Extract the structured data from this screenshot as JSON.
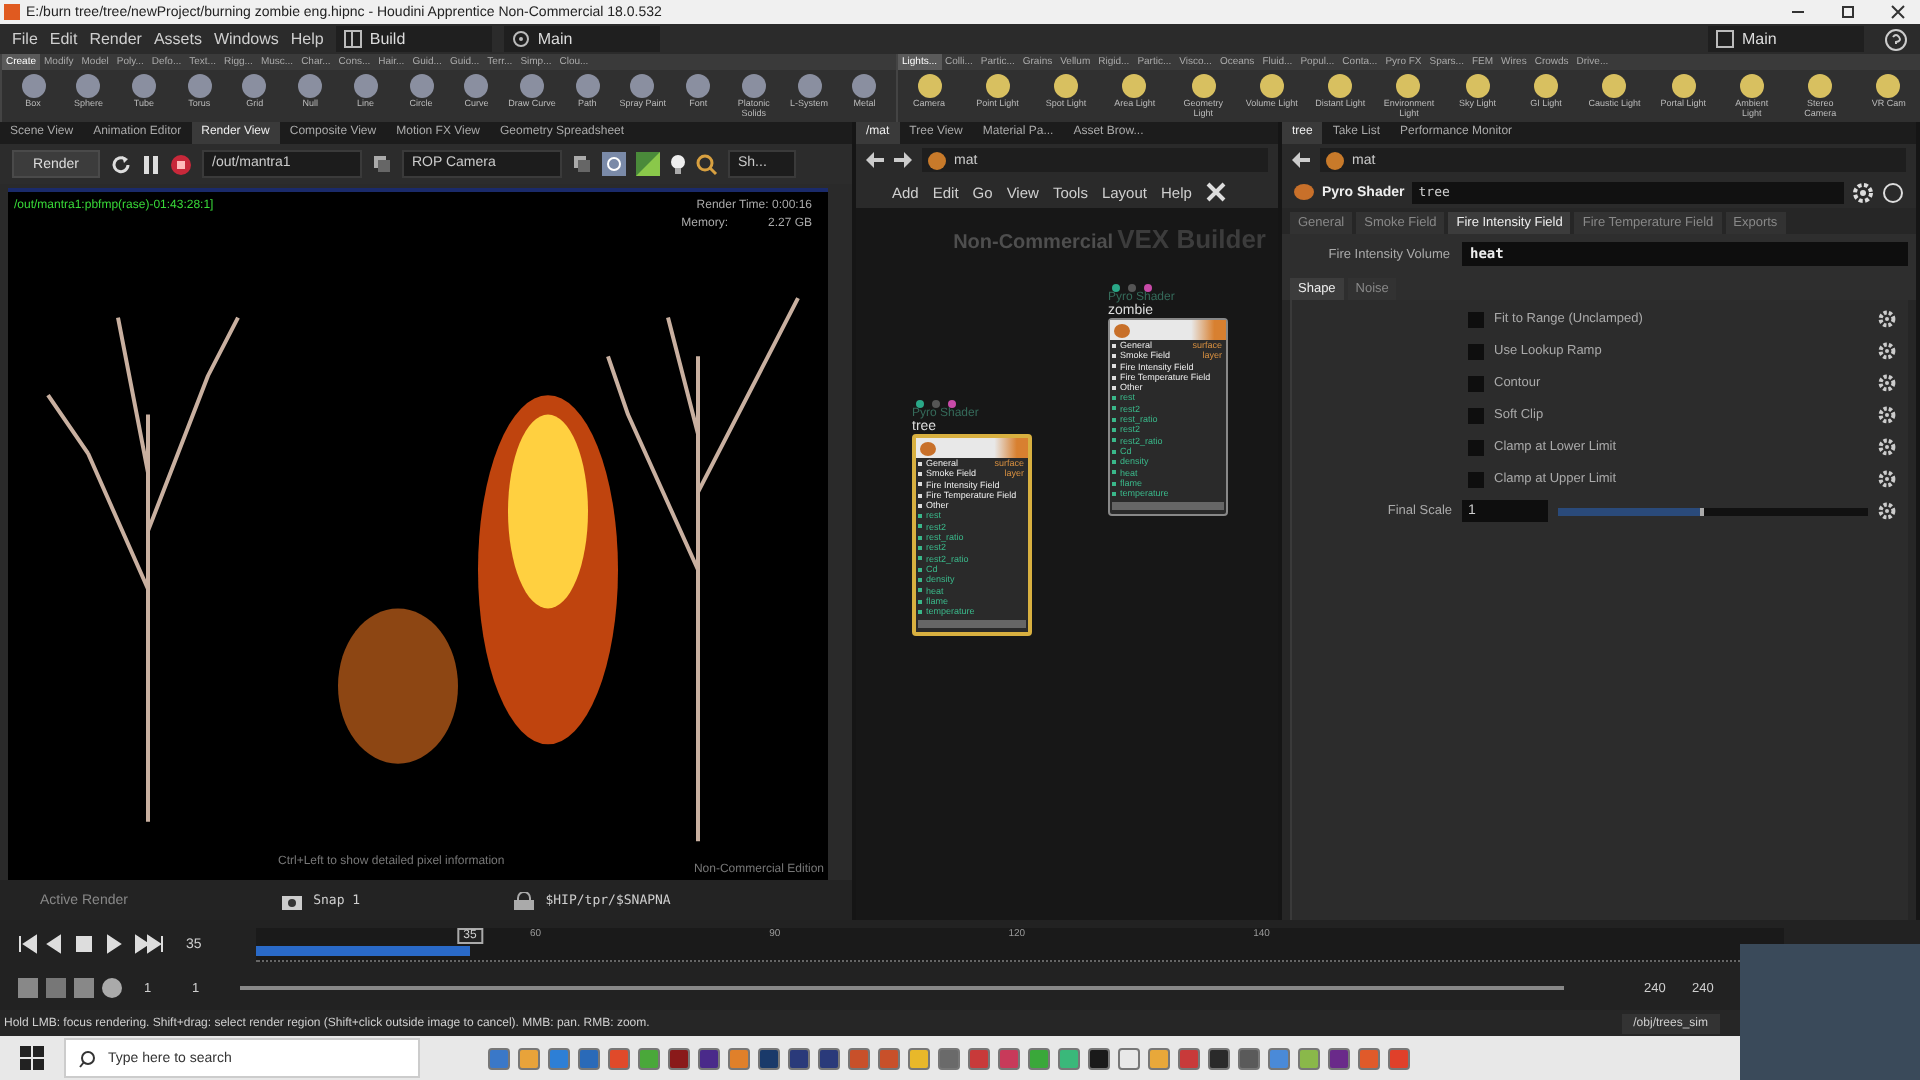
{
  "window": {
    "title": "E:/burn tree/tree/newProject/burning zombie eng.hipnc - Houdini Apprentice Non-Commercial 18.0.532"
  },
  "menu": [
    "File",
    "Edit",
    "Render",
    "Assets",
    "Windows",
    "Help"
  ],
  "desktop": "Build",
  "desk_view": "Main",
  "right_desk": "Main",
  "shelf_left": {
    "tabs": [
      {
        "label": "Create",
        "selected": true
      },
      {
        "label": "Modify",
        "selected": false
      },
      {
        "label": "Model",
        "selected": false
      },
      {
        "label": "Poly...",
        "selected": false
      },
      {
        "label": "Defo...",
        "selected": false
      },
      {
        "label": "Text...",
        "selected": false
      },
      {
        "label": "Rigg...",
        "selected": false
      },
      {
        "label": "Musc...",
        "selected": false
      },
      {
        "label": "Char...",
        "selected": false
      },
      {
        "label": "Cons...",
        "selected": false
      },
      {
        "label": "Hair...",
        "selected": false
      },
      {
        "label": "Guid...",
        "selected": false
      },
      {
        "label": "Guid...",
        "selected": false
      },
      {
        "label": "Terr...",
        "selected": false
      },
      {
        "label": "Simp...",
        "selected": false
      },
      {
        "label": "Clou...",
        "selected": false
      }
    ],
    "tools": [
      "Box",
      "Sphere",
      "Tube",
      "Torus",
      "Grid",
      "Null",
      "Line",
      "Circle",
      "Curve",
      "Draw Curve",
      "Path",
      "Spray Paint",
      "Font",
      "Platonic Solids",
      "L-System",
      "Metal"
    ]
  },
  "shelf_right": {
    "tabs": [
      {
        "label": "Lights...",
        "selected": true
      },
      {
        "label": "Colli...",
        "selected": false
      },
      {
        "label": "Partic...",
        "selected": false
      },
      {
        "label": "Grains",
        "selected": false
      },
      {
        "label": "Vellum",
        "selected": false
      },
      {
        "label": "Rigid...",
        "selected": false
      },
      {
        "label": "Partic...",
        "selected": false
      },
      {
        "label": "Visco...",
        "selected": false
      },
      {
        "label": "Oceans",
        "selected": false
      },
      {
        "label": "Fluid...",
        "selected": false
      },
      {
        "label": "Popul...",
        "selected": false
      },
      {
        "label": "Conta...",
        "selected": false
      },
      {
        "label": "Pyro FX",
        "selected": false
      },
      {
        "label": "Spars...",
        "selected": false
      },
      {
        "label": "FEM",
        "selected": false
      },
      {
        "label": "Wires",
        "selected": false
      },
      {
        "label": "Crowds",
        "selected": false
      },
      {
        "label": "Drive...",
        "selected": false
      }
    ],
    "tools": [
      "Camera",
      "Point Light",
      "Spot Light",
      "Area Light",
      "Geometry Light",
      "Volume Light",
      "Distant Light",
      "Environment Light",
      "Sky Light",
      "GI Light",
      "Caustic Light",
      "Portal Light",
      "Ambient Light",
      "Stereo Camera",
      "VR Cam"
    ]
  },
  "render_view": {
    "tabs": [
      {
        "label": "Scene View",
        "selected": false
      },
      {
        "label": "Animation Editor",
        "selected": false
      },
      {
        "label": "Render View",
        "selected": true
      },
      {
        "label": "Composite View",
        "selected": false
      },
      {
        "label": "Motion FX View",
        "selected": false
      },
      {
        "label": "Geometry Spreadsheet",
        "selected": false
      }
    ],
    "render_button": "Render",
    "rop": "/out/mantra1",
    "camera": "ROP Camera",
    "shading": "Sh...",
    "overlay_path": "/out/mantra1:pbfmp(rase)-01:43:28:1]",
    "render_time": "Render Time: 0:00:16",
    "memory_label": "Memory:",
    "memory": "2.27 GB",
    "hint": "Ctrl+Left to show detailed pixel information",
    "edition": "Non-Commercial Edition",
    "active_render": "Active Render",
    "snap": "Snap 1",
    "snap_path": "$HIP/tpr/$SNAPNA"
  },
  "network": {
    "tabs": [
      {
        "label": "/mat",
        "selected": true
      },
      {
        "label": "Tree View",
        "selected": false
      },
      {
        "label": "Material Pa...",
        "selected": false
      },
      {
        "label": "Asset Brow...",
        "selected": false
      }
    ],
    "path": "mat",
    "menu": [
      "Add",
      "Edit",
      "Go",
      "View",
      "Tools",
      "Layout",
      "Help"
    ],
    "stamp": "Non-Commercial",
    "context": "VEX Builder",
    "nodes": [
      {
        "type": "Pyro Shader",
        "name": "zombie",
        "selected": false,
        "inputs": [
          "General",
          "Smoke Field",
          "Fire Intensity Field",
          "Fire Temperature Field",
          "Other"
        ],
        "outputs": [
          "surface",
          "layer"
        ],
        "ports": [
          "rest",
          "rest2",
          "rest_ratio",
          "rest2",
          "rest2_ratio",
          "Cd",
          "density",
          "heat",
          "flame",
          "temperature"
        ]
      },
      {
        "type": "Pyro Shader",
        "name": "tree",
        "selected": true,
        "inputs": [
          "General",
          "Smoke Field",
          "Fire Intensity Field",
          "Fire Temperature Field",
          "Other"
        ],
        "outputs": [
          "surface",
          "layer"
        ],
        "ports": [
          "rest",
          "rest2",
          "rest_ratio",
          "rest2",
          "rest2_ratio",
          "Cd",
          "density",
          "heat",
          "flame",
          "temperature"
        ]
      }
    ]
  },
  "params": {
    "tabs": [
      {
        "label": "tree",
        "selected": true
      },
      {
        "label": "Take List",
        "selected": false
      },
      {
        "label": "Performance Monitor",
        "selected": false
      }
    ],
    "path": "mat",
    "node_type": "Pyro Shader",
    "node_name": "tree",
    "folders": [
      {
        "label": "General",
        "selected": false
      },
      {
        "label": "Smoke Field",
        "selected": false
      },
      {
        "label": "Fire Intensity Field",
        "selected": true
      },
      {
        "label": "Fire Temperature Field",
        "selected": false
      },
      {
        "label": "Exports",
        "selected": false
      }
    ],
    "volume_label": "Fire Intensity Volume",
    "volume_value": "heat",
    "subfolders": [
      {
        "label": "Shape",
        "selected": true
      },
      {
        "label": "Noise",
        "selected": false
      }
    ],
    "toggles": [
      {
        "label": "Fit to Range (Unclamped)",
        "checked": false
      },
      {
        "label": "Use Lookup Ramp",
        "checked": false
      },
      {
        "label": "Contour",
        "checked": false
      },
      {
        "label": "Soft Clip",
        "checked": false
      },
      {
        "label": "Clamp at Lower Limit",
        "checked": false
      },
      {
        "label": "Clamp at Upper Limit",
        "checked": false
      }
    ],
    "scale_label": "Final Scale",
    "scale_value": "1",
    "scale": {
      "level": 0.47
    }
  },
  "timeline": {
    "frame": "35",
    "marker": "35",
    "range": {
      "level": 0.14
    },
    "ticks": [
      "60",
      "90",
      "120",
      "140"
    ],
    "start": "1",
    "start2": "1",
    "end": "240",
    "end2": "240"
  },
  "status": {
    "text": "Hold LMB: focus rendering. Shift+drag: select render region (Shift+click outside image to cancel). MMB: pan. RMB: zoom.",
    "path": "/obj/trees_sim"
  },
  "taskbar": {
    "search": "Type here to search",
    "apps": [
      {
        "color": "#3a78c8"
      },
      {
        "color": "#e8a33a"
      },
      {
        "color": "#2d7fd6"
      },
      {
        "color": "#2a6ab8"
      },
      {
        "color": "#e04a2a"
      },
      {
        "color": "#4aa83a"
      },
      {
        "color": "#8a1a1a"
      },
      {
        "color": "#4a2a8a"
      },
      {
        "color": "#e0802a"
      },
      {
        "color": "#1a3a6a"
      },
      {
        "color": "#2a3a7a"
      },
      {
        "color": "#2a3a7a"
      },
      {
        "color": "#c8502a"
      },
      {
        "color": "#c8502a"
      },
      {
        "color": "#e8b82a"
      },
      {
        "color": "#6a6a6a"
      },
      {
        "color": "#c83a3a"
      },
      {
        "color": "#c83a5a"
      },
      {
        "color": "#3aa83a"
      },
      {
        "color": "#3ab87a"
      },
      {
        "color": "#1a1a1a"
      },
      {
        "color": "#e8e8e8"
      },
      {
        "color": "#e8a83a"
      },
      {
        "color": "#c83a3a"
      },
      {
        "color": "#2a2a2a"
      },
      {
        "color": "#5a5a5a"
      },
      {
        "color": "#4a8ad8"
      },
      {
        "color": "#8ab84a"
      },
      {
        "color": "#6a2a8a"
      },
      {
        "color": "#e05a2a"
      },
      {
        "color": "#e0402a"
      }
    ]
  }
}
